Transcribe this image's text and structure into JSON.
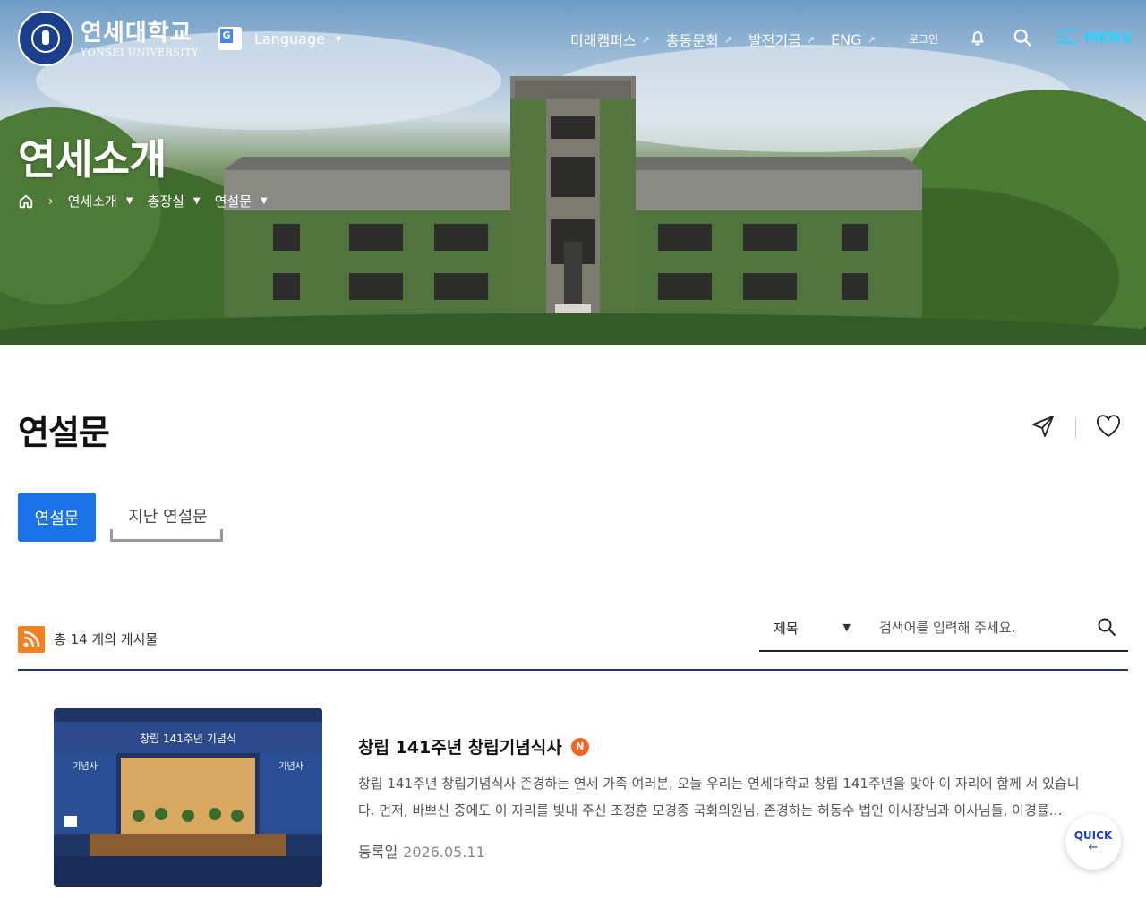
{
  "header": {
    "logo_ko": "연세대학교",
    "logo_en": "YONSEI UNIVERSITY",
    "language_label": "Language",
    "nav": [
      {
        "label": "미래캠퍼스"
      },
      {
        "label": "총동문회"
      },
      {
        "label": "발전기금"
      },
      {
        "label": "ENG"
      }
    ],
    "login_label": "로그인",
    "menu_label": "MENU"
  },
  "hero": {
    "title": "연세소개",
    "breadcrumb": [
      "연세소개",
      "총장실",
      "연설문"
    ]
  },
  "page": {
    "title": "연설문",
    "tabs": [
      {
        "label": "연설문",
        "active": true
      },
      {
        "label": "지난 연설문",
        "active": false
      }
    ]
  },
  "list": {
    "total_text": "총 14 개의 게시물",
    "search_scope": "제목",
    "search_placeholder": "검색어를 입력해 주세요."
  },
  "posts": [
    {
      "title": "창립 141주년 창립기념식사",
      "badge": "N",
      "excerpt": "창립 141주년 창립기념식사 존경하는 연세 가족 여러분, 오늘 우리는 연세대학교 창립 141주년을 맞아 이 자리에 함께 서 있습니다. 먼저, 바쁘신 중에도 이 자리를 빛내 주신 조정훈 모경종 국회의원님, 존경하는 허동수 법인 이사장님과 이사님들, 이경률…",
      "date_label": "등록일",
      "date": "2026.05.11",
      "thumb_banner": "창립 141주년 기념식",
      "thumb_side_left": "기념사",
      "thumb_side_right": "기념사"
    }
  ],
  "quick": {
    "label": "QUICK",
    "arrow": "←"
  },
  "colors": {
    "accent": "#1a73e8",
    "menu": "#2bd0ff",
    "rss": "#f48024",
    "badge": "#f26522",
    "line": "#1b3a6b"
  }
}
